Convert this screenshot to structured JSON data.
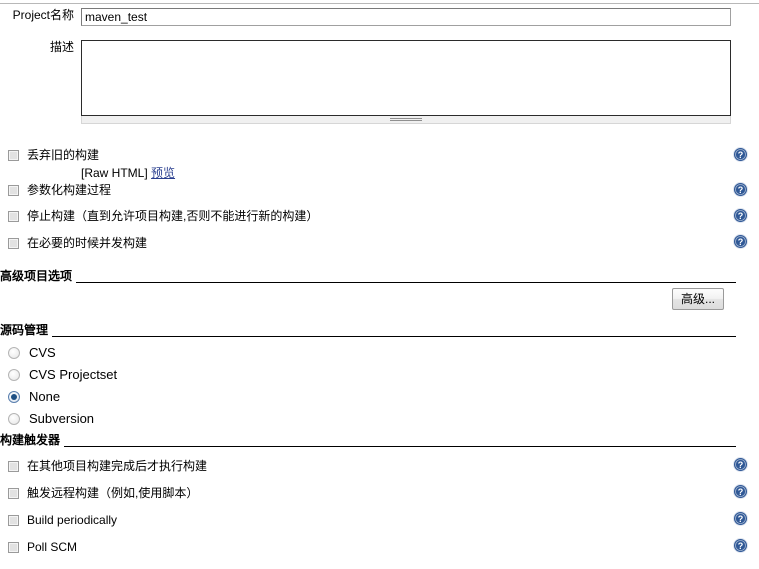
{
  "form": {
    "project_name": {
      "label": "Project名称",
      "value": "maven_test"
    },
    "description": {
      "label": "描述",
      "value": "",
      "raw_html_text": "[Raw HTML]",
      "preview_link": "预览"
    }
  },
  "general_options": [
    {
      "label": "丢弃旧的构建",
      "checked": false
    },
    {
      "label": "参数化构建过程",
      "checked": false
    },
    {
      "label": "停止构建（直到允许项目构建,否则不能进行新的构建）",
      "checked": false
    },
    {
      "label": "在必要的时候并发构建",
      "checked": false
    }
  ],
  "sections": {
    "advanced_project_options": {
      "title": "高级项目选项",
      "advanced_button": "高级..."
    },
    "source_code_management": {
      "title": "源码管理",
      "options": [
        {
          "label": "CVS",
          "selected": false
        },
        {
          "label": "CVS Projectset",
          "selected": false
        },
        {
          "label": "None",
          "selected": true
        },
        {
          "label": "Subversion",
          "selected": false
        }
      ]
    },
    "build_triggers": {
      "title": "构建触发器",
      "options": [
        {
          "label": "在其他项目构建完成后才执行构建",
          "checked": false
        },
        {
          "label": "触发远程构建（例如,使用脚本）",
          "checked": false
        },
        {
          "label": "Build periodically",
          "checked": false
        },
        {
          "label": "Poll SCM",
          "checked": false
        }
      ]
    }
  },
  "icons": {
    "help": "help-icon"
  },
  "colors": {
    "help_icon_blue": "#2f5896",
    "section_rule": "#000000",
    "link": "#2a3f8f"
  }
}
